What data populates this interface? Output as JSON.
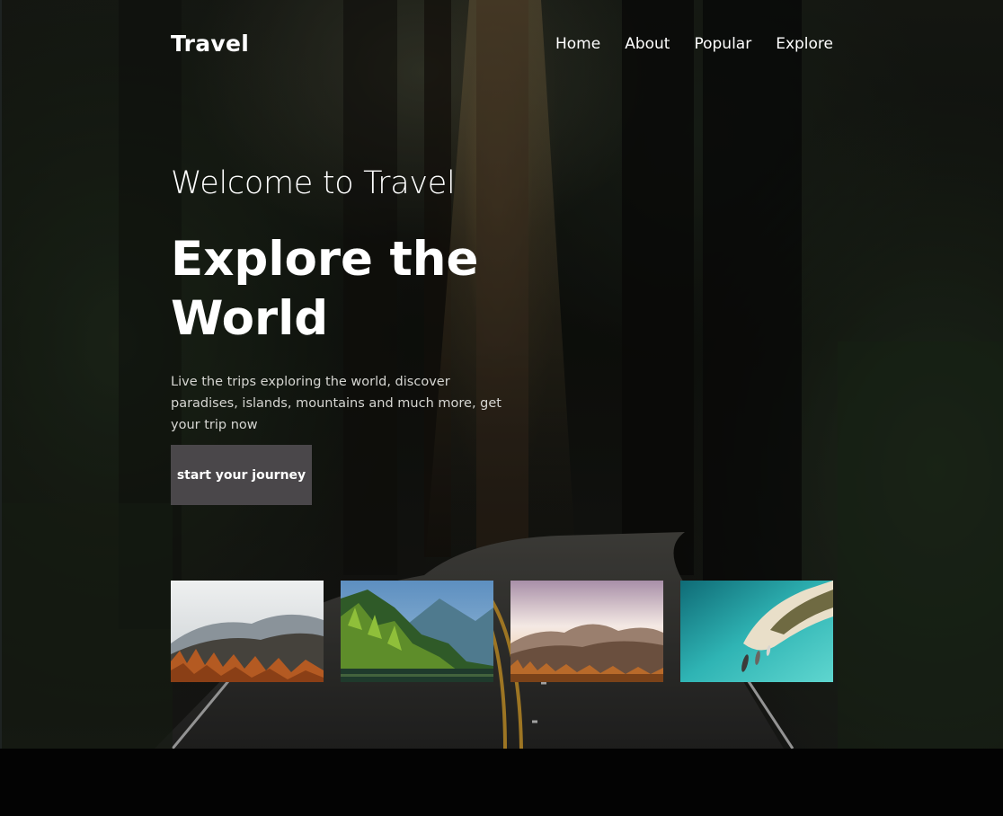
{
  "header": {
    "logo": "Travel",
    "nav": [
      "Home",
      "About",
      "Popular",
      "Explore"
    ]
  },
  "hero": {
    "welcome": "Welcome to Travel",
    "headline_line1": "Explore the",
    "headline_line2": "World",
    "description": "Live the trips exploring the world, discover paradises, islands, mountains and much more, get your trip now",
    "cta_label": "start your journey"
  },
  "gallery": {
    "items": [
      {
        "scene": "autumn-forest-mountains"
      },
      {
        "scene": "green-forest-lake"
      },
      {
        "scene": "sunset-mountains"
      },
      {
        "scene": "tropical-island-beach"
      }
    ]
  },
  "colors": {
    "cta_background": "#4a474a",
    "text": "#ffffff",
    "footer": "#030303"
  }
}
